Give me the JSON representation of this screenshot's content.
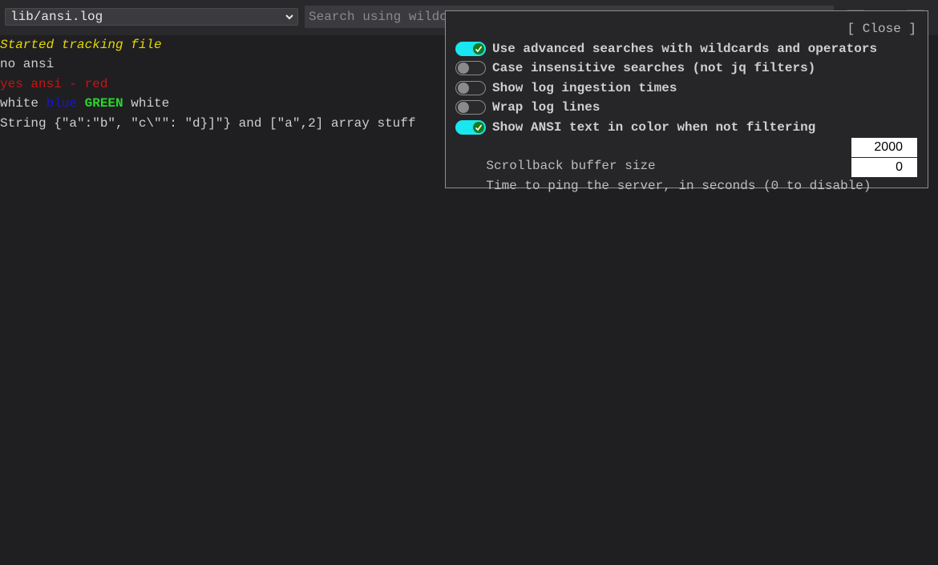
{
  "header": {
    "file_select": {
      "value": "lib/ansi.log"
    },
    "search": {
      "placeholder": "Search using wildcards"
    }
  },
  "log_lines": [
    {
      "segments": [
        {
          "text": "Started tracking file",
          "style": "yellow-italic"
        }
      ]
    },
    {
      "segments": [
        {
          "text": "no ansi",
          "style": "default"
        }
      ]
    },
    {
      "segments": [
        {
          "text": "yes ansi - red",
          "style": "red"
        }
      ]
    },
    {
      "segments": [
        {
          "text": "white ",
          "style": "default"
        },
        {
          "text": "blue",
          "style": "blue"
        },
        {
          "text": " ",
          "style": "default"
        },
        {
          "text": "GREEN",
          "style": "green-bold"
        },
        {
          "text": " white",
          "style": "default"
        }
      ]
    },
    {
      "segments": [
        {
          "text": "String {\"a\":\"b\", \"c\\\"\": \"d}]\"} and [\"a\",2] array stuff",
          "style": "default"
        }
      ]
    }
  ],
  "settings": {
    "close_label": "[ Close ]",
    "options": [
      {
        "label": "Use advanced searches with wildcards and operators",
        "enabled": true
      },
      {
        "label": "Case insensitive searches (not jq filters)",
        "enabled": false
      },
      {
        "label": "Show log ingestion times",
        "enabled": false
      },
      {
        "label": "Wrap log lines",
        "enabled": false
      },
      {
        "label": "Show ANSI text in color when not filtering",
        "enabled": true
      }
    ],
    "scrollback": {
      "label": "Scrollback buffer size",
      "value": "2000"
    },
    "ping": {
      "label": "Time to ping the server, in seconds (0 to disable)",
      "value": "0"
    }
  },
  "colors": {
    "background": "#1f1f21",
    "toggle_on": "#19e6ee",
    "ansi_red": "#d01010",
    "ansi_blue": "#1515d8",
    "ansi_green": "#2ad62a",
    "log_header_yellow": "#e5d800"
  },
  "icons": {
    "select_chevron": "chevron-down-icon",
    "toggle_check": "check-icon"
  }
}
